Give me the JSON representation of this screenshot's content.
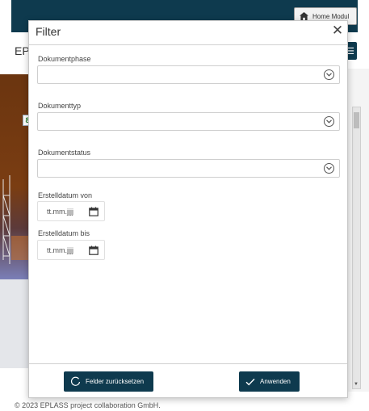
{
  "app": {
    "home_button_label": "Home Modul",
    "page_title_fragment": "EP",
    "menu_icon": "hamburger-icon",
    "footer_text": "© 2023 EPLASS project collaboration GmbH."
  },
  "modal": {
    "title": "Filter",
    "close_icon": "close-icon",
    "fields": {
      "document_phase": {
        "label": "Dokumentphase",
        "value": ""
      },
      "document_type": {
        "label": "Dokumenttyp",
        "value": ""
      },
      "document_status": {
        "label": "Dokumentstatus",
        "value": ""
      },
      "created_from": {
        "label": "Erstelldatum von",
        "placeholder": "tt.mm.jjjj"
      },
      "created_to": {
        "label": "Erstelldatum bis",
        "placeholder": "tt.mm.jjjj"
      }
    },
    "buttons": {
      "reset_label": "Felder zurücksetzen",
      "apply_label": "Anwenden"
    }
  },
  "colors": {
    "primary": "#0e3a4e",
    "border": "#cfcfcf"
  }
}
